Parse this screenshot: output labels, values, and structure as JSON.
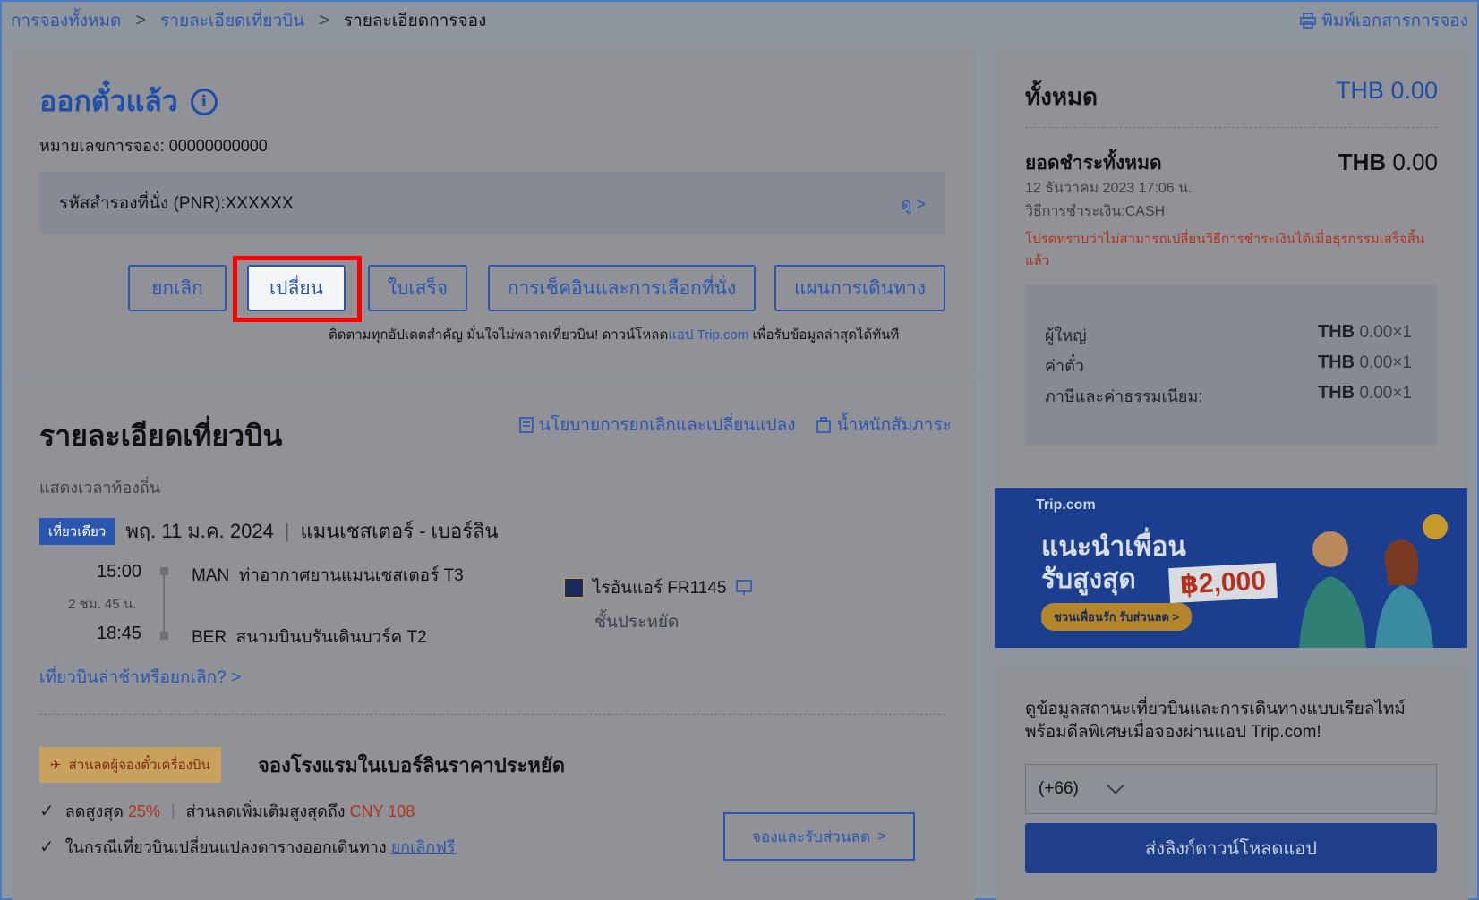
{
  "breadcrumb": {
    "all_bookings": "การจองทั้งหมด",
    "flight_details": "รายละเอียดเที่ยวบิน",
    "booking_details": "รายละเอียดการจอง",
    "separator": ">"
  },
  "print_label": "พิมพ์เอกสารการจอง",
  "status": {
    "title": "ออกตั๋วแล้ว",
    "info_glyph": "i"
  },
  "booking_number": "หมายเลขการจอง: 00000000000",
  "pnr": {
    "label": "รหัสสำรองที่นั่ง (PNR):XXXXXX",
    "view": "ดู >"
  },
  "actions": {
    "cancel": "ยกเลิก",
    "change": "เปลี่ยน",
    "receipt": "ใบเสร็จ",
    "checkin_seat": "การเช็คอินและการเลือกที่นั่ง",
    "itinerary": "แผนการเดินทาง"
  },
  "download_note": {
    "prefix": "ติดตามทุกอัปเดตสำคัญ มั่นใจไม่พลาดเที่ยวบิน! ดาวน์โหลด",
    "link": "แอป Trip.com",
    "suffix": " เพื่อรับข้อมูลล่าสุดได้ทันที"
  },
  "flight": {
    "section_title": "รายละเอียดเที่ยวบิน",
    "policy_link": "นโยบายการยกเลิกและเปลี่ยนแปลง",
    "baggage_link": "น้ำหนักสัมภาระ",
    "local_time": "แสดงเวลาท้องถิ่น",
    "trip_type": "เที่ยวเดียว",
    "date": "พฤ. 11 ม.ค. 2024",
    "divider": "|",
    "route": "แมนเชสเตอร์ - เบอร์ลิน",
    "dep_time": "15:00",
    "duration": "2 ชม. 45 น.",
    "arr_time": "18:45",
    "dep_code": "MAN",
    "dep_airport": "ท่าอากาศยานแมนเชสเตอร์ T3",
    "arr_code": "BER",
    "arr_airport": "สนามบินบรันเดินบวร์ค T2",
    "airline": "ไรอันแอร์ FR1145",
    "cabin": "ชั้นประหยัด",
    "delay_link": "เที่ยวบินล่าช้าหรือยกเลิก? >"
  },
  "promo": {
    "badge": "ส่วนลดผู้จองตั๋วเครื่องบิน",
    "title": "จองโรงแรมในเบอร์ลินราคาประหยัด",
    "line1_a": "ลดสูงสุด ",
    "line1_pct": "25%",
    "line1_sep": "|",
    "line1_b": "ส่วนลดเพิ่มเติมสูงสุดถึง ",
    "line1_cny": "CNY 108",
    "line2_a": "ในกรณีเที่ยวบินเปลี่ยนแปลงตารางออกเดินทาง ",
    "line2_link": "ยกเลิกฟรี",
    "book_button": "จองและรับส่วนลด"
  },
  "summary": {
    "total_label": "ทั้งหมด",
    "total_value": "THB 0.00",
    "paid_label": "ยอดชำระทั้งหมด",
    "paid_currency": "THB",
    "paid_amount": "0.00",
    "pay_date": "12 ธันวาคม 2023 17:06 น.",
    "pay_method": "วิธีการชำระเงิน:CASH",
    "warning": "โปรดทราบว่าไม่สามารถเปลี่ยนวิธีการชำระเงินได้เมื่อธุรกรรมเสร็จสิ้นแล้ว",
    "rows": [
      {
        "label": "ผู้ใหญ่",
        "currency": "THB",
        "amount": "0.00×1"
      },
      {
        "label": "ค่าตั๋ว",
        "currency": "THB",
        "amount": "0.00×1"
      },
      {
        "label": "ภาษีและค่าธรรมเนียม:",
        "currency": "THB",
        "amount": "0.00×1"
      }
    ]
  },
  "banner": {
    "brand": "Trip.com",
    "line1": "แนะนำเพื่อน",
    "line2": "รับสูงสุด",
    "amount": "฿2,000",
    "cta": "ชวนเพื่อนรัก รับส่วนลด >"
  },
  "app": {
    "text": "ดูข้อมูลสถานะเที่ยวบินและการเดินทางแบบเรียลไทม์ พร้อมดีลพิเศษเมื่อจองผ่านแอป Trip.com!",
    "country_code": "(+66)",
    "send_button": "ส่งลิงก์ดาวน์โหลดแอป"
  },
  "colors": {
    "accent": "#2a55b0",
    "highlight": "#ff0000",
    "warning": "#b5311e"
  }
}
